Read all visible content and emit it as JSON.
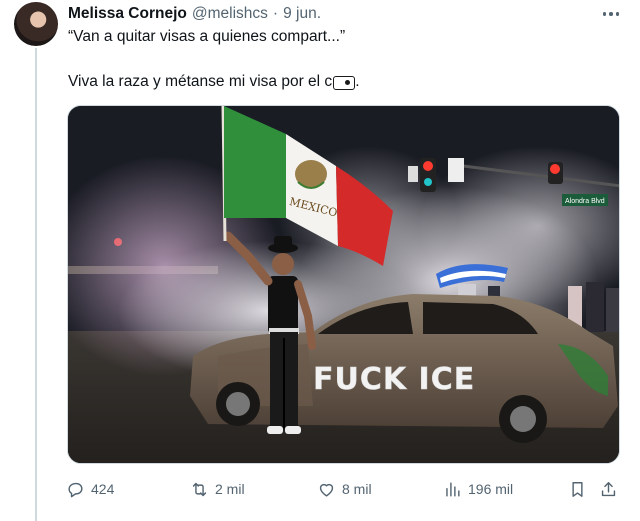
{
  "tweet": {
    "author": {
      "display_name": "Melissa Cornejo",
      "handle": "@melishcs",
      "separator": "·",
      "date": "9 jun."
    },
    "text_line1": "“Van a quitar visas a quienes compart...”",
    "text_line2": "Viva la raza y métanse mi visa por el c",
    "text_line2_end": ".",
    "emoji_name": "censored-emoji-icon",
    "media": {
      "flag_text": "MEXICO",
      "graffiti": "FUCK ICE",
      "street_sign": "Alondra Blvd",
      "accent_colors": {
        "flag_green": "#2f8f3a",
        "flag_red": "#d42a2a",
        "smoke": "#d9d6db"
      }
    },
    "actions": {
      "replies": "424",
      "reposts": "2 mil",
      "likes": "8 mil",
      "views": "196 mil"
    }
  }
}
